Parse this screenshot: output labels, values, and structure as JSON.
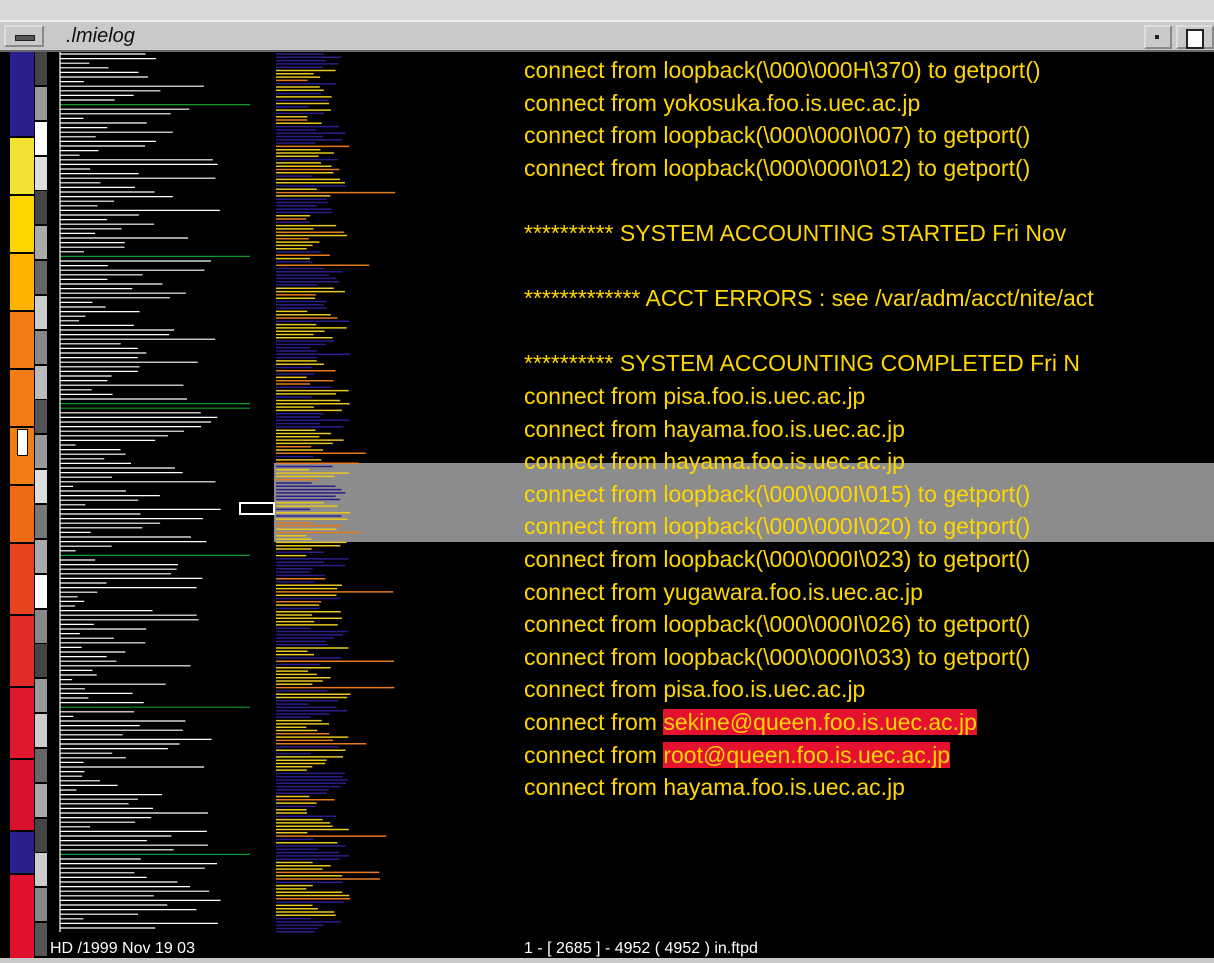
{
  "window": {
    "title": ".lmielog"
  },
  "colors": {
    "text": "#ffd700",
    "highlight": "#e4122e",
    "selection": "#8c8c8c",
    "background": "#000000",
    "histogram_line": "#ffffff",
    "histogram_marker": "#0a9b2a",
    "overview_blue": "#2b1e8c",
    "overview_yellow": "#e8c81e",
    "overview_orange": "#e87a1e"
  },
  "colorbar": [
    {
      "color": "#2a1f8f",
      "weight": 6
    },
    {
      "color": "#f2e132",
      "weight": 4
    },
    {
      "color": "#ffd400",
      "weight": 4
    },
    {
      "color": "#ffb300",
      "weight": 4
    },
    {
      "color": "#f27d14",
      "weight": 4
    },
    {
      "color": "#f27d14",
      "weight": 4
    },
    {
      "color": "#f27d14",
      "weight": 4
    },
    {
      "color": "#ef6a14",
      "weight": 4
    },
    {
      "color": "#e8421e",
      "weight": 5
    },
    {
      "color": "#e22a28",
      "weight": 5
    },
    {
      "color": "#e0182e",
      "weight": 5
    },
    {
      "color": "#d8122e",
      "weight": 5
    },
    {
      "color": "#2a1f8f",
      "weight": 3
    },
    {
      "color": "#e0122e",
      "weight": 6
    }
  ],
  "log": {
    "lines": [
      {
        "text": "connect from loopback(\\000\\000H\\370) to getport()",
        "highlight": ""
      },
      {
        "text": "connect from yokosuka.foo.is.uec.ac.jp",
        "highlight": ""
      },
      {
        "text": "connect from loopback(\\000\\000I\\007) to getport()",
        "highlight": ""
      },
      {
        "text": "connect from loopback(\\000\\000I\\012) to getport()",
        "highlight": ""
      },
      {
        "text": "",
        "highlight": ""
      },
      {
        "text": "********** SYSTEM ACCOUNTING STARTED Fri Nov",
        "highlight": ""
      },
      {
        "text": "",
        "highlight": ""
      },
      {
        "text": "************* ACCT ERRORS : see /var/adm/acct/nite/act",
        "highlight": ""
      },
      {
        "text": "",
        "highlight": ""
      },
      {
        "text": "********** SYSTEM ACCOUNTING COMPLETED Fri N",
        "highlight": ""
      },
      {
        "text": "connect from pisa.foo.is.uec.ac.jp",
        "highlight": ""
      },
      {
        "text": "connect from hayama.foo.is.uec.ac.jp",
        "highlight": ""
      },
      {
        "text": "connect from hayama.foo.is.uec.ac.jp",
        "highlight": ""
      },
      {
        "text": "connect from loopback(\\000\\000I\\015) to getport()",
        "highlight": ""
      },
      {
        "text": "connect from loopback(\\000\\000I\\020) to getport()",
        "highlight": ""
      },
      {
        "text": "connect from loopback(\\000\\000I\\023) to getport()",
        "highlight": ""
      },
      {
        "text": "connect from yugawara.foo.is.uec.ac.jp",
        "highlight": ""
      },
      {
        "text": "connect from loopback(\\000\\000I\\026) to getport()",
        "highlight": ""
      },
      {
        "text": "connect from loopback(\\000\\000I\\033) to getport()",
        "highlight": ""
      },
      {
        "text": "connect from pisa.foo.is.uec.ac.jp",
        "highlight": ""
      },
      {
        "text": "connect from ",
        "highlight": "sekine@queen.foo.is.uec.ac.jp"
      },
      {
        "text": "connect from ",
        "highlight": "root@queen.foo.is.uec.ac.jp"
      },
      {
        "text": "connect from hayama.foo.is.uec.ac.jp",
        "highlight": ""
      }
    ]
  },
  "status": {
    "left": "HD /1999 Nov 19 03",
    "right": "1 - [ 2685 ] - 4952 ( 4952 ) in.ftpd"
  }
}
